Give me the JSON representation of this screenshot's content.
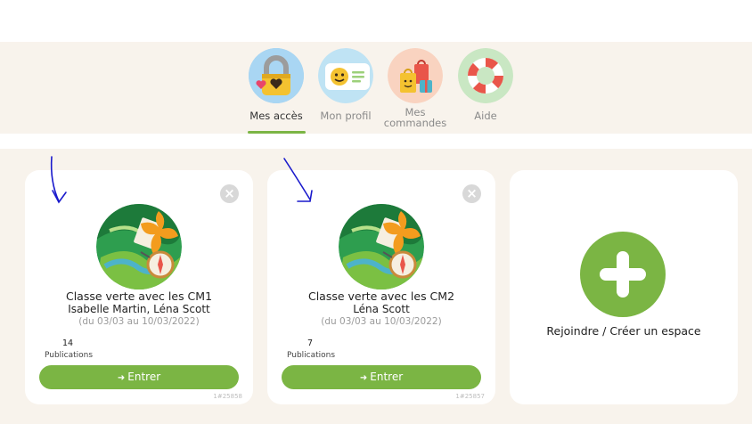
{
  "nav": {
    "items": [
      {
        "label": "Mes accès",
        "icon": "lock-hearts-icon",
        "active": true
      },
      {
        "label": "Mon profil",
        "icon": "profile-card-icon",
        "active": false
      },
      {
        "label": "Mes\ncommandes",
        "icon": "shopping-bags-icon",
        "active": false
      },
      {
        "label": "Aide",
        "icon": "lifebuoy-icon",
        "active": false
      }
    ]
  },
  "cards": [
    {
      "title": "Classe verte avec les CM1",
      "owners": "Isabelle Martin, Léna Scott",
      "dates": "(du 03/03 au 10/03/2022)",
      "publications_count": "14",
      "publications_label": "Publications",
      "enter_label": "Entrer",
      "ref": "1#25858",
      "close_label": "×",
      "icon": "nature-compass-icon"
    },
    {
      "title": "Classe verte avec les CM2",
      "owners": "Léna Scott",
      "dates": "(du 03/03 au 10/03/2022)",
      "publications_count": "7",
      "publications_label": "Publications",
      "enter_label": "Entrer",
      "ref": "1#25857",
      "close_label": "×",
      "icon": "nature-compass-icon"
    }
  ],
  "join": {
    "label": "Rejoindre / Créer un espace",
    "icon": "plus-icon"
  },
  "colors": {
    "accent": "#7bb544",
    "background": "#f8f3ec",
    "annotation": "#1a1acc"
  }
}
